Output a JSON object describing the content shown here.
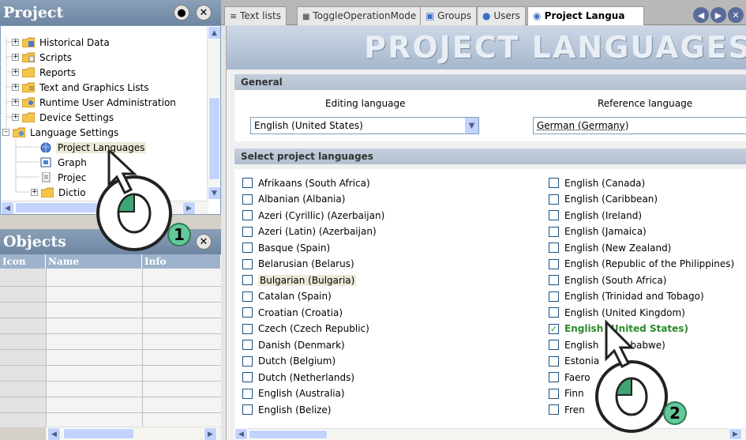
{
  "project_pane": {
    "title": "Project",
    "tree": [
      {
        "label": "Historical Data",
        "icon": "historical-data-icon"
      },
      {
        "label": "Scripts",
        "icon": "scripts-icon"
      },
      {
        "label": "Reports",
        "icon": "reports-icon"
      },
      {
        "label": "Text and Graphics Lists",
        "icon": "text-graphics-lists-icon"
      },
      {
        "label": "Runtime User Administration",
        "icon": "user-admin-icon"
      },
      {
        "label": "Device Settings",
        "icon": "device-settings-icon"
      },
      {
        "label": "Language Settings",
        "icon": "language-settings-icon"
      },
      {
        "label": "Project Languages",
        "icon": "globe-icon"
      },
      {
        "label": "Graph",
        "icon": "graphics-icon"
      },
      {
        "label": "Projec",
        "icon": "document-icon"
      },
      {
        "label": "Dictio",
        "icon": "dictionary-icon"
      }
    ]
  },
  "objects_pane": {
    "title": "Objects",
    "columns": [
      "Icon",
      "Name",
      "Info"
    ]
  },
  "tabs": [
    {
      "label": "Text lists",
      "icon": "text-lists-icon"
    },
    {
      "label": "ToggleOperationMode",
      "icon": "script-icon"
    },
    {
      "label": "Groups",
      "icon": "groups-icon"
    },
    {
      "label": "Users",
      "icon": "user-icon"
    },
    {
      "label": "Project Langua",
      "icon": "globe-icon",
      "active": true
    }
  ],
  "editor": {
    "title": "PROJECT LANGUAGES",
    "general_header": "General",
    "editing_language_label": "Editing language",
    "reference_language_label": "Reference language",
    "editing_language_value": "English (United States)",
    "reference_language_value": "German (Germany)",
    "select_header": "Select project languages",
    "languages_col1": [
      {
        "label": "Afrikaans (South Africa)",
        "checked": false
      },
      {
        "label": "Albanian (Albania)",
        "checked": false
      },
      {
        "label": "Azeri (Cyrillic) (Azerbaijan)",
        "checked": false
      },
      {
        "label": "Azeri (Latin) (Azerbaijan)",
        "checked": false
      },
      {
        "label": "Basque (Spain)",
        "checked": false
      },
      {
        "label": "Belarusian (Belarus)",
        "checked": false
      },
      {
        "label": "Bulgarian (Bulgaria)",
        "checked": false
      },
      {
        "label": "Catalan (Spain)",
        "checked": false
      },
      {
        "label": "Croatian (Croatia)",
        "checked": false
      },
      {
        "label": "Czech (Czech Republic)",
        "checked": false
      },
      {
        "label": "Danish (Denmark)",
        "checked": false
      },
      {
        "label": "Dutch (Belgium)",
        "checked": false
      },
      {
        "label": "Dutch (Netherlands)",
        "checked": false
      },
      {
        "label": "English (Australia)",
        "checked": false
      },
      {
        "label": "English (Belize)",
        "checked": false
      }
    ],
    "languages_col2": [
      {
        "label": "English (Canada)",
        "checked": false
      },
      {
        "label": "English (Caribbean)",
        "checked": false
      },
      {
        "label": "English (Ireland)",
        "checked": false
      },
      {
        "label": "English (Jamaica)",
        "checked": false
      },
      {
        "label": "English (New Zealand)",
        "checked": false
      },
      {
        "label": "English (Republic of the Philippines)",
        "checked": false
      },
      {
        "label": "English (South Africa)",
        "checked": false
      },
      {
        "label": "English (Trinidad and Tobago)",
        "checked": false
      },
      {
        "label": "English (United Kingdom)",
        "checked": false
      },
      {
        "label": "English (United States)",
        "checked": true
      },
      {
        "label": "English",
        "checked": false,
        "partial": "babwe)"
      },
      {
        "label": "Estonia",
        "checked": false
      },
      {
        "label": "Faero",
        "checked": false,
        "partial": "nds)"
      },
      {
        "label": "Finn",
        "checked": false
      },
      {
        "label": "Fren",
        "checked": false
      }
    ]
  },
  "callouts": [
    {
      "number": "1"
    },
    {
      "number": "2"
    }
  ],
  "colors": {
    "header_blue": "#7890ad",
    "checked_green": "#2a8a2a",
    "callout_green": "#64c89a"
  }
}
